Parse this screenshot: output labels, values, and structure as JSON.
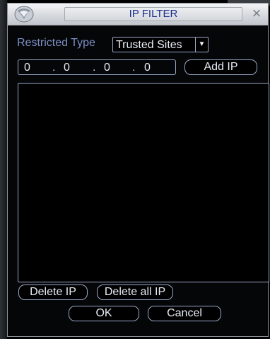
{
  "window": {
    "title": "IP FILTER",
    "close_symbol": "×"
  },
  "restricted_type": {
    "label": "Restricted Type",
    "selected": "Trusted Sites",
    "arrow": "▼"
  },
  "ip_input": {
    "octets": [
      "0",
      "0",
      "0",
      "0"
    ],
    "separator": "."
  },
  "buttons": {
    "add_ip": "Add IP",
    "delete_ip": "Delete IP",
    "delete_all_ip": "Delete all IP",
    "ok": "OK",
    "cancel": "Cancel"
  },
  "ip_list": {
    "items": []
  },
  "colors": {
    "title_text": "#1d2f8c",
    "label_text": "#7d8fc4",
    "control_border": "#9aa8c8",
    "background": "#000000"
  },
  "icons": {
    "logo": "dvr-logo-icon",
    "close": "close-icon",
    "dropdown": "chevron-down-icon"
  }
}
